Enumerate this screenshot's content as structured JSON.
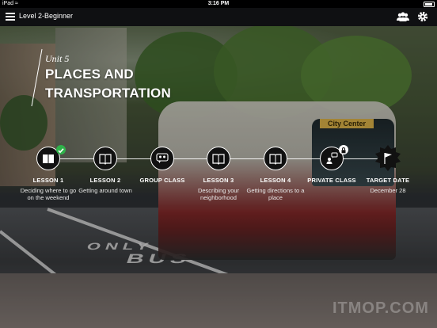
{
  "status_bar": {
    "carrier": "iPad",
    "wifi_icon": "wifi-icon",
    "time": "3:16 PM"
  },
  "app_bar": {
    "title": "Level 2-Beginner",
    "menu_icon": "hamburger-icon",
    "community_icon": "people-icon",
    "settings_icon": "gear-icon"
  },
  "unit": {
    "label": "Unit 5",
    "title_line1": "PLACES AND",
    "title_line2": "TRANSPORTATION"
  },
  "background_text": {
    "tram_sign": "City Center",
    "road_line1": "ONLY",
    "road_line2": "BUS"
  },
  "timeline": [
    {
      "title": "LESSON 1",
      "subtitle": "Deciding where to go on the weekend",
      "icon": "book-icon",
      "status": "completed"
    },
    {
      "title": "LESSON 2",
      "subtitle": "Getting around town",
      "icon": "book-icon"
    },
    {
      "title": "GROUP CLASS",
      "subtitle": "",
      "icon": "group-chat-icon"
    },
    {
      "title": "LESSON 3",
      "subtitle": "Describing your neighborhood",
      "icon": "book-icon"
    },
    {
      "title": "LESSON 4",
      "subtitle": "Getting directions to a place",
      "icon": "book-icon"
    },
    {
      "title": "PRIVATE CLASS",
      "subtitle": "",
      "icon": "private-chat-icon",
      "status": "locked"
    },
    {
      "title": "TARGET DATE",
      "subtitle": "December 28",
      "icon": "flag-icon"
    }
  ],
  "watermark": "ITMOP.COM",
  "colors": {
    "completed": "#2fb24a",
    "node_fill": "#111111",
    "app_bar": "#0f1012"
  }
}
